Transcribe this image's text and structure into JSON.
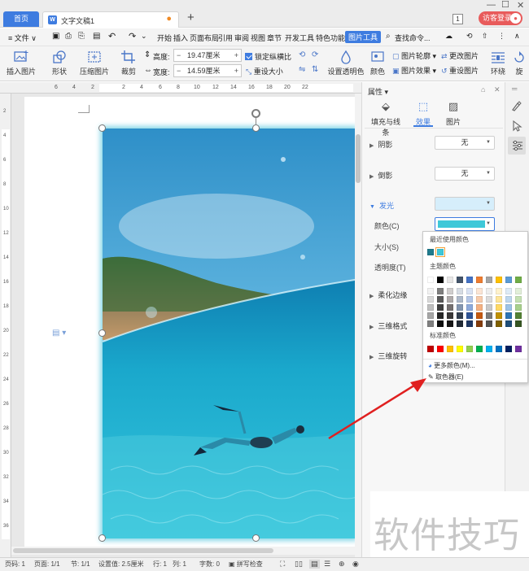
{
  "titlebar": {
    "home_tab": "首页",
    "doc_tab": "文字文稿1",
    "doc_icon": "W",
    "new_tab": "+",
    "window_count": "1",
    "login": "访客登录"
  },
  "menubar": {
    "file": "≡ 文件 ∨",
    "items": [
      "开始",
      "插入",
      "页面布局",
      "引用",
      "审阅",
      "视图",
      "章节",
      "开发工具",
      "特色功能"
    ],
    "picture_tools": "图片工具",
    "search": "查找命令..."
  },
  "ribbon": {
    "insert_picture": "插入图片",
    "shape": "形状",
    "compress": "压缩图片",
    "crop": "裁剪",
    "height_label": "高度:",
    "height_value": "19.47厘米",
    "width_label": "宽度:",
    "width_value": "14.59厘米",
    "lock_ratio": "锁定纵横比",
    "reset_size": "重设大小",
    "set_transparent": "设置透明色",
    "color": "颜色",
    "picture_outline": "图片轮廓",
    "change_picture": "更改图片",
    "picture_effect": "图片效果",
    "reset_picture": "重设图片",
    "wrap": "环绕",
    "rotate": "旋"
  },
  "ruler": {
    "h_ticks": [
      "6",
      "4",
      "2",
      "",
      "2",
      "4",
      "6",
      "8",
      "10",
      "12",
      "14",
      "16",
      "18",
      "20",
      "22"
    ],
    "v_ticks": [
      "2",
      "4",
      "6",
      "8",
      "10",
      "12",
      "14",
      "16",
      "18",
      "20",
      "22",
      "24",
      "26",
      "28",
      "30",
      "32",
      "34",
      "36"
    ]
  },
  "panel": {
    "title": "属性",
    "tabs": [
      "填充与线条",
      "效果",
      "图片"
    ],
    "shadow": "阴影",
    "shadow_value": "无",
    "reflection": "倒影",
    "reflection_value": "无",
    "glow": "发光",
    "glow_color_label": "颜色(C)",
    "glow_size_label": "大小(S)",
    "glow_transparency_label": "透明度(T)",
    "soft_edges": "柔化边缘",
    "three_d_format": "三维格式",
    "three_d_rotation": "三维旋转",
    "glow_color": "#3ec8d8"
  },
  "popup": {
    "recent": "最近使用颜色",
    "theme": "主题颜色",
    "standard": "标准颜色",
    "more_colors": "更多颜色(M)...",
    "eyedropper": "取色器(E)",
    "recent_colors": [
      "#1f7a8c",
      "#3ec8d8"
    ],
    "theme_top": [
      "#ffffff",
      "#000000",
      "#e7e6e6",
      "#44546a",
      "#4472c4",
      "#ed7d31",
      "#a5a5a5",
      "#ffc000",
      "#5b9bd5",
      "#70ad47"
    ],
    "theme_cols": [
      [
        "#f2f2f2",
        "#d9d9d9",
        "#bfbfbf",
        "#a6a6a6",
        "#808080"
      ],
      [
        "#7f7f7f",
        "#595959",
        "#404040",
        "#262626",
        "#0d0d0d"
      ],
      [
        "#d0cece",
        "#aeaaaa",
        "#757070",
        "#3a3838",
        "#171616"
      ],
      [
        "#d6dce4",
        "#adb9ca",
        "#8496b0",
        "#333f4f",
        "#222a35"
      ],
      [
        "#d9e2f3",
        "#b4c6e7",
        "#8eaadb",
        "#2f5496",
        "#1f3864"
      ],
      [
        "#fbe5d5",
        "#f7cbac",
        "#f4b183",
        "#c55a11",
        "#843c0b"
      ],
      [
        "#ededed",
        "#dbdbdb",
        "#c9c9c9",
        "#7b7b7b",
        "#525252"
      ],
      [
        "#fff2cc",
        "#fee599",
        "#ffd965",
        "#bf9000",
        "#7f6000"
      ],
      [
        "#deebf6",
        "#bdd7ee",
        "#9dc3e6",
        "#2e75b5",
        "#1f4e79"
      ],
      [
        "#e2efd9",
        "#c5e0b3",
        "#a8d08d",
        "#538135",
        "#375623"
      ]
    ],
    "standard_colors": [
      "#c00000",
      "#ff0000",
      "#ffc000",
      "#ffff00",
      "#92d050",
      "#00b050",
      "#00b0f0",
      "#0070c0",
      "#002060",
      "#7030a0"
    ]
  },
  "statusbar": {
    "page_code": "页码: 1",
    "page": "页面: 1/1",
    "section": "节: 1/1",
    "setting": "设置值: 2.5厘米",
    "row": "行: 1",
    "col": "列: 1",
    "words": "字数: 0",
    "spell": "拼写检查"
  },
  "watermark": "软件技巧"
}
